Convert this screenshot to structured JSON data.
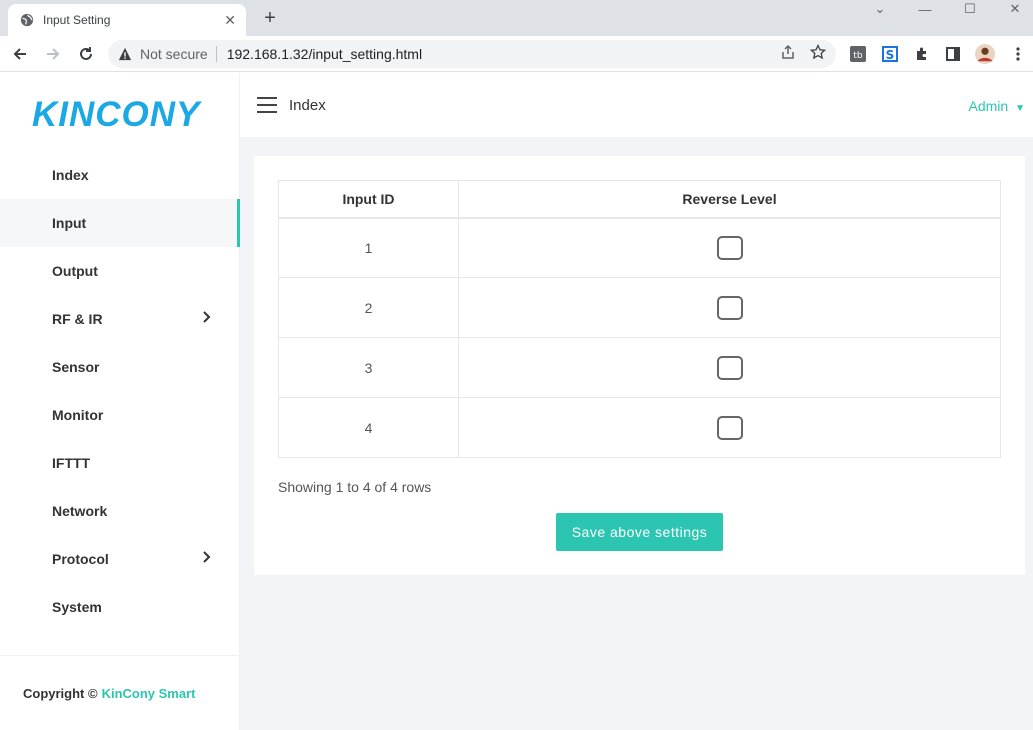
{
  "browser": {
    "tab_title": "Input Setting",
    "security_label": "Not secure",
    "url": "192.168.1.32/input_setting.html"
  },
  "app": {
    "logo_text": "KINCONY",
    "header_title": "Index",
    "user_menu": "Admin",
    "accent_color": "#2bc5b2",
    "logo_color": "#1ba8e5"
  },
  "sidebar": {
    "items": [
      {
        "label": "Index"
      },
      {
        "label": "Input"
      },
      {
        "label": "Output"
      },
      {
        "label": "RF & IR"
      },
      {
        "label": "Sensor"
      },
      {
        "label": "Monitor"
      },
      {
        "label": "IFTTT"
      },
      {
        "label": "Network"
      },
      {
        "label": "Protocol"
      },
      {
        "label": "System"
      }
    ],
    "active": "Input",
    "footer_prefix": "Copyright ©",
    "footer_brand": "KinCony Smart"
  },
  "table": {
    "headers": [
      "Input ID",
      "Reverse Level"
    ],
    "rows": [
      {
        "id": "1",
        "reverse": false
      },
      {
        "id": "2",
        "reverse": false
      },
      {
        "id": "3",
        "reverse": false
      },
      {
        "id": "4",
        "reverse": false
      }
    ],
    "pagination_text": "Showing 1 to 4 of 4 rows"
  },
  "actions": {
    "save_label": "Save above settings"
  }
}
